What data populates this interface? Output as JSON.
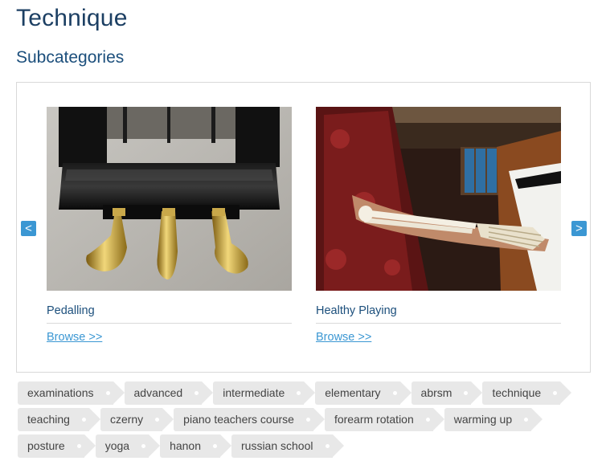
{
  "page": {
    "title": "Technique",
    "subcategories_heading": "Subcategories"
  },
  "carousel": {
    "prev_label": "<",
    "next_label": ">",
    "cards": [
      {
        "title": "Pedalling",
        "link": "Browse >>",
        "image": "piano-pedals-photo"
      },
      {
        "title": "Healthy Playing",
        "link": "Browse >>",
        "image": "arm-bones-at-piano-photo"
      }
    ]
  },
  "tags": {
    "rows": [
      [
        "examinations",
        "advanced",
        "intermediate",
        "elementary",
        "abrsm",
        "technique"
      ],
      [
        "teaching",
        "czerny",
        "piano teachers course",
        "forearm rotation",
        "warming up"
      ],
      [
        "posture",
        "yoga",
        "hanon",
        "russian school"
      ]
    ]
  },
  "colors": {
    "heading": "#1c3f63",
    "accent": "#3b97d3",
    "tag_bg": "#e8e8e8",
    "border": "#d9d9d9"
  }
}
